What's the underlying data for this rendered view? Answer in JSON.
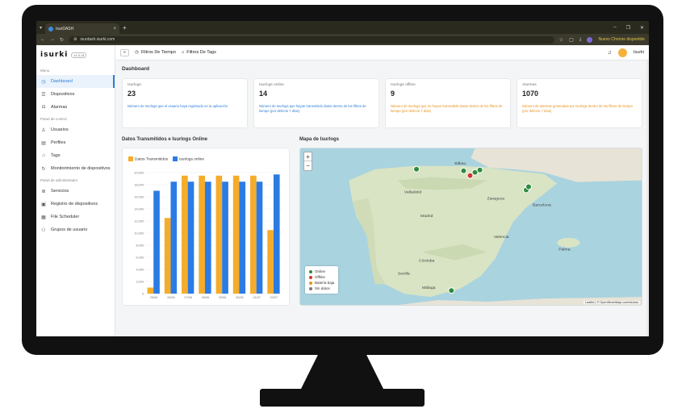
{
  "browser": {
    "tab_title": "IsurDASH",
    "url": "isurdash.isurki.com",
    "update_notice": "Nuevo Chrome disponible"
  },
  "app": {
    "brand": "isurki",
    "version": "v1.0.14"
  },
  "sidebar": {
    "sections": [
      {
        "label": "Menu",
        "items": [
          {
            "label": "Dashboard",
            "icon": "clock-icon",
            "active": true
          },
          {
            "label": "Dispositivos",
            "icon": "list-icon"
          },
          {
            "label": "Alarmas",
            "icon": "alarm-icon"
          }
        ]
      },
      {
        "label": "Panel de control",
        "items": [
          {
            "label": "Usuarios",
            "icon": "user-icon"
          },
          {
            "label": "Perfiles",
            "icon": "profile-icon"
          },
          {
            "label": "Tags",
            "icon": "tag-icon"
          },
          {
            "label": "Monitorimiento de dispositivos",
            "icon": "refresh-icon"
          }
        ]
      },
      {
        "label": "Panel de administrador",
        "items": [
          {
            "label": "Servicios",
            "icon": "stack-icon"
          },
          {
            "label": "Registro de dispositivos",
            "icon": "register-icon"
          },
          {
            "label": "File Scheduler",
            "icon": "calendar-icon"
          },
          {
            "label": "Grupos de usuario",
            "icon": "group-icon"
          }
        ]
      }
    ]
  },
  "topbar": {
    "filter_time": "Filtros De Tiempo",
    "filter_tags": "Filtros De Tags",
    "user_name": "Isurki"
  },
  "dashboard": {
    "title": "Dashboard",
    "kpis": [
      {
        "label": "Isurlogs",
        "value": "23",
        "desc": "Número de Isurlogs que el usuario haya registrado en la aplicación",
        "tone": "blue"
      },
      {
        "label": "Isurlogs online",
        "value": "14",
        "desc": "Número de Isurlogs que hayan transmitido datos dentro de los filtros de tiempo (por defecto 7 días)",
        "tone": "blue"
      },
      {
        "label": "Isurlogs offline",
        "value": "9",
        "desc": "Número de Isurlogs que no hayan transmitido datos dentro de los filtros de tiempo (por defecto 7 días)",
        "tone": "orange"
      },
      {
        "label": "Alarmas",
        "value": "1070",
        "desc": "Número de alarmas generadas por Isurlogs dentro de los filtros de tiempo (por defecto 7 días)",
        "tone": "orange"
      }
    ]
  },
  "chart_panel": {
    "title": "Datos Transmitidos e Isurlogs Online"
  },
  "map_panel": {
    "title": "Mapa de Isurlogs",
    "zoom_in": "+",
    "zoom_out": "−",
    "attribution": "Leaflet | © OpenStreetMap contributors",
    "legend": [
      {
        "label": "Online",
        "color": "#2e8b3e"
      },
      {
        "label": "Offline",
        "color": "#d0392b"
      },
      {
        "label": "Batería baja",
        "color": "#e6921e"
      },
      {
        "label": "Sin datos",
        "color": "#7a7a7a"
      }
    ],
    "places": [
      "Madrid",
      "Zaragoza",
      "Barcelona",
      "Valencia",
      "Sevilla",
      "Málaga",
      "Córdoba",
      "Valladolid",
      "Bilbao",
      "Palma"
    ]
  },
  "colors": {
    "accent": "#2d7fd3",
    "bar_data": "#f5ac2a",
    "bar_online": "#2b7be4"
  },
  "chart_data": {
    "type": "bar",
    "categories": [
      "25/06",
      "26/06",
      "27/06",
      "28/06",
      "29/06",
      "30/06",
      "01/07",
      "02/07"
    ],
    "series": [
      {
        "name": "Datos Transmitidos",
        "values": [
          1000,
          12500,
          19500,
          19500,
          19500,
          19500,
          19500,
          10500
        ]
      },
      {
        "name": "Isurlogs online",
        "values": [
          17000,
          18500,
          18500,
          18500,
          18500,
          18500,
          18500,
          19700
        ]
      }
    ],
    "yticks": [
      "0",
      "2,000",
      "4,000",
      "6,000",
      "8,000",
      "10,000",
      "12,000",
      "14,000",
      "16,000",
      "18,000",
      "20,000"
    ],
    "ylim": [
      0,
      20000
    ],
    "legend": "top-left"
  }
}
